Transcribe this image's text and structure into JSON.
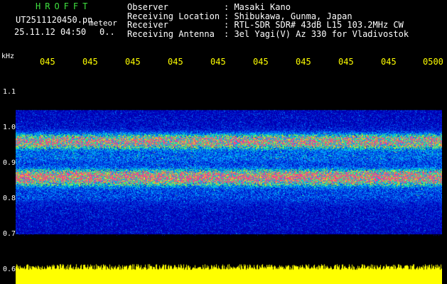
{
  "header": {
    "title": "HROFFT",
    "filename": "UT2511120450.pn",
    "meteor_label": "meteor",
    "datetime": "25.11.12 04:50",
    "extra_value": "0.."
  },
  "meta": {
    "observer_key": "Observer",
    "observer_val": ": Masaki Kano",
    "location_key": "Receiving Location",
    "location_val": ": Shibukawa, Gunma, Japan",
    "receiver_key": "Receiver",
    "receiver_val": ": RTL-SDR SDR# 43dB L15 103.2MHz CW",
    "antenna_key": "Receiving Antenna",
    "antenna_val": ": 3el Yagi(V) Az 330 for Vladivostok"
  },
  "y_axis": {
    "label": "kHz",
    "ticks": [
      "1.1",
      "1.0",
      "0.9",
      "0.8",
      "0.7",
      "0.6"
    ]
  },
  "x_axis": {
    "ticks": [
      "045",
      "045",
      "045",
      "045",
      "045",
      "045",
      "045",
      "045",
      "045",
      "0500"
    ]
  },
  "colors": {
    "background": "#000000",
    "x_tick_text": "#ffff00",
    "title": "#3fe03f",
    "power_trace": "#ffff00",
    "strong_signal": "#ff3a8c"
  }
}
